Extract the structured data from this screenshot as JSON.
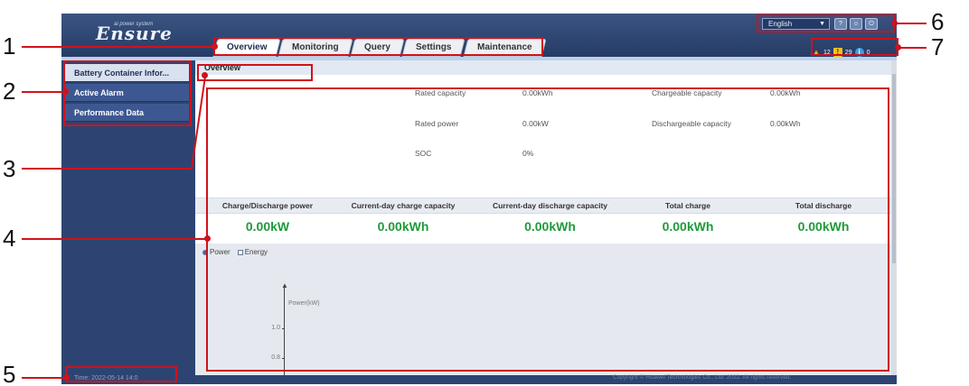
{
  "header": {
    "logo_text": "Ensure",
    "logo_tagline": "ai power system",
    "language": "English"
  },
  "tabs": [
    {
      "label": "Overview"
    },
    {
      "label": "Monitoring"
    },
    {
      "label": "Query"
    },
    {
      "label": "Settings"
    },
    {
      "label": "Maintenance"
    }
  ],
  "alarms": {
    "major": "12",
    "minor": "29",
    "warning": "0"
  },
  "sidebar": {
    "items": [
      {
        "label": "Battery Container Infor..."
      },
      {
        "label": "Active Alarm"
      },
      {
        "label": "Performance Data"
      }
    ]
  },
  "footer": {
    "time": "Time: 2022-05-14 14:0",
    "copyright": "Copyright © Huawei Technologies Co., Ltd. 2022. All rights reserved."
  },
  "breadcrumb": "Overview",
  "info": {
    "rated_capacity_label": "Rated capacity",
    "rated_capacity_value": "0.00kWh",
    "rated_power_label": "Rated power",
    "rated_power_value": "0.00kW",
    "soc_label": "SOC",
    "soc_value": "0%",
    "chargeable_label": "Chargeable capacity",
    "chargeable_value": "0.00kWh",
    "dischargeable_label": "Dischargeable capacity",
    "dischargeable_value": "0.00kWh"
  },
  "stats": [
    {
      "label": "Charge/Discharge power",
      "value": "0.00kW"
    },
    {
      "label": "Current-day charge capacity",
      "value": "0.00kWh"
    },
    {
      "label": "Current-day discharge capacity",
      "value": "0.00kWh"
    },
    {
      "label": "Total charge",
      "value": "0.00kWh"
    },
    {
      "label": "Total discharge",
      "value": "0.00kWh"
    }
  ],
  "chart": {
    "toggle_power": "Power",
    "toggle_energy": "Energy",
    "y_label": "Power(kW)",
    "y_ticks": [
      "1.0",
      "0.8"
    ]
  },
  "callouts": [
    "1",
    "2",
    "3",
    "4",
    "5",
    "6",
    "7"
  ],
  "colors": {
    "callout": "#d0121b",
    "value_green": "#1f9a3c",
    "frame_blue": "#2d4472"
  }
}
